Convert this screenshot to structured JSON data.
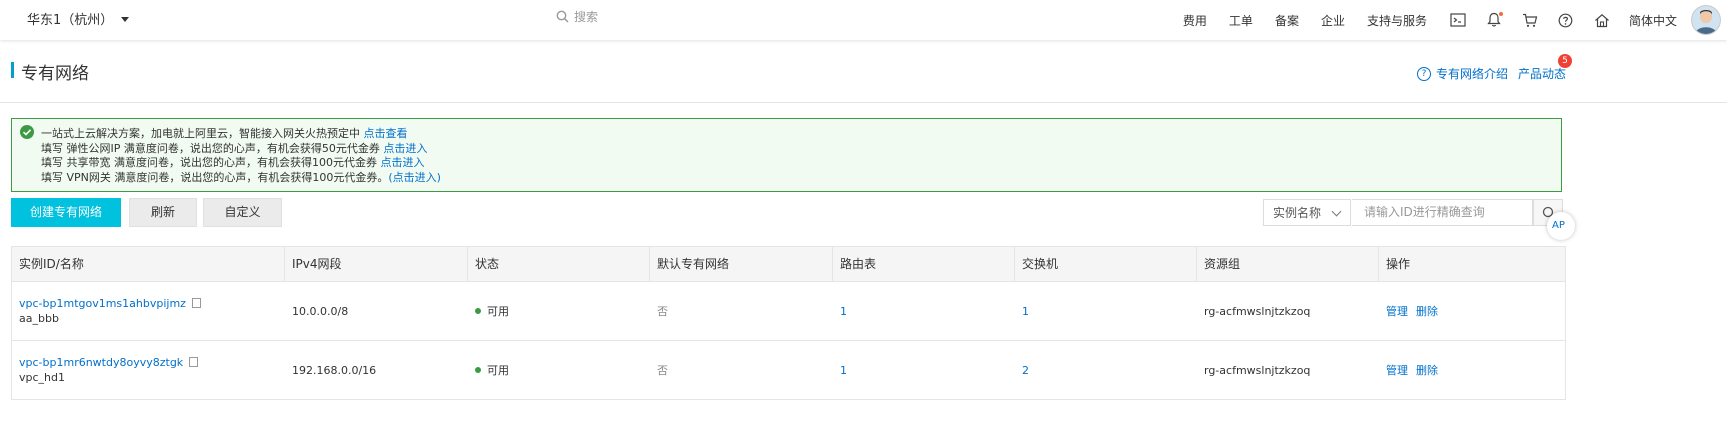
{
  "topbar": {
    "region": "华东1（杭州）",
    "search_placeholder": "搜索",
    "nav": [
      "费用",
      "工单",
      "备案",
      "企业",
      "支持与服务"
    ],
    "lang": "简体中文",
    "icons": [
      "terminal-icon",
      "bell-icon",
      "cart-icon",
      "help-icon",
      "home-icon"
    ]
  },
  "header": {
    "title": "专有网络",
    "intro_link": "专有网络介绍",
    "news_link": "产品动态",
    "news_badge": "5"
  },
  "notice": {
    "line1_text": "一站式上云解决方案，加电就上阿里云，智能接入网关火热预定中",
    "line1_link": "点击查看",
    "line2_text": "填写 弹性公网IP 满意度问卷，说出您的心声，有机会获得50元代金券",
    "line2_link": "点击进入",
    "line3_text": "填写 共享带宽 满意度问卷，说出您的心声，有机会获得100元代金券",
    "line3_link": "点击进入",
    "line4_text": "填写 VPN网关 满意度问卷，说出您的心声，有机会获得100元代金券。",
    "line4_link": "(点击进入)"
  },
  "toolbar": {
    "create": "创建专有网络",
    "refresh": "刷新",
    "custom": "自定义",
    "filter_select": "实例名称",
    "search_placeholder": "请输入ID进行精确查询",
    "api_label": "AP"
  },
  "table": {
    "columns": [
      "实例ID/名称",
      "IPv4网段",
      "状态",
      "默认专有网络",
      "路由表",
      "交换机",
      "资源组",
      "操作"
    ],
    "rows": [
      {
        "id": "vpc-bp1mtgov1ms1ahbvpijmz",
        "name": "aa_bbb",
        "cidr": "10.0.0.0/8",
        "status": "可用",
        "default": "否",
        "route_tables": "1",
        "vswitches": "1",
        "resource_group": "rg-acfmwslnjtzkzoq",
        "manage": "管理",
        "delete": "删除"
      },
      {
        "id": "vpc-bp1mr6nwtdy8oyvy8ztgk",
        "name": "vpc_hd1",
        "cidr": "192.168.0.0/16",
        "status": "可用",
        "default": "否",
        "route_tables": "1",
        "vswitches": "2",
        "resource_group": "rg-acfmwslnjtzkzoq",
        "manage": "管理",
        "delete": "删除"
      }
    ]
  },
  "colors": {
    "accent": "#00c1de",
    "link": "#0070cc",
    "success": "#3d9a44",
    "badge": "#f04134"
  }
}
